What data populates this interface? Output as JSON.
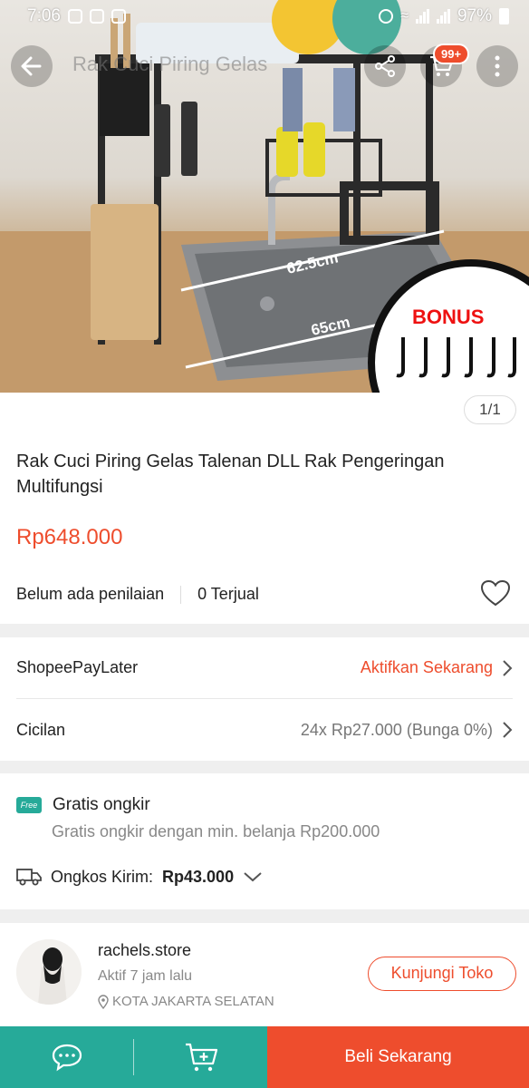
{
  "status_bar": {
    "time": "7:06",
    "battery": "97%"
  },
  "header": {
    "ghost_title": "Rak Cuci Piring Gelas",
    "cart_badge": "99+"
  },
  "gallery": {
    "counter": "1/1",
    "overlay_labels": {
      "width_top": "62.5cm",
      "width_bottom": "65cm",
      "bonus": "BONUS"
    }
  },
  "product": {
    "title": "Rak Cuci Piring Gelas Talenan DLL Rak Pengeringan Multifungsi",
    "price": "Rp648.000",
    "rating_text": "Belum ada penilaian",
    "sold_text": "0 Terjual"
  },
  "payment": {
    "paylater_label": "ShopeePayLater",
    "paylater_action": "Aktifkan Sekarang",
    "installment_label": "Cicilan",
    "installment_value": "24x Rp27.000 (Bunga 0%)"
  },
  "shipping": {
    "free_badge": "Free",
    "free_title": "Gratis ongkir",
    "free_sub": "Gratis ongkir dengan min. belanja Rp200.000",
    "cost_label": "Ongkos Kirim:",
    "cost_value": "Rp43.000"
  },
  "shop": {
    "name": "rachels.store",
    "active": "Aktif 7 jam lalu",
    "location": "KOTA JAKARTA SELATAN",
    "visit_label": "Kunjungi Toko"
  },
  "bottom_bar": {
    "buy_label": "Beli Sekarang"
  },
  "colors": {
    "accent": "#ee4d2d",
    "teal": "#26aa99"
  }
}
